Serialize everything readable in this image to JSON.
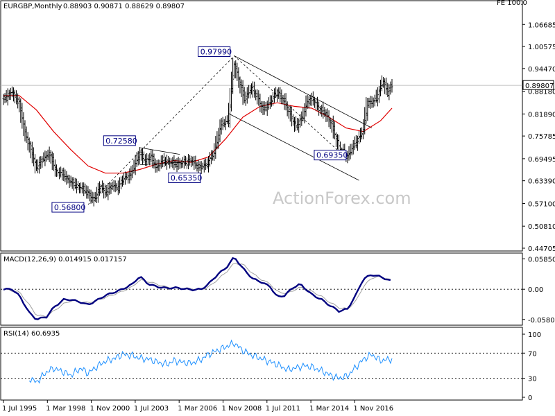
{
  "watermark": "ActionForex.com",
  "corner_label": "FE 100.0",
  "chart_data": [
    {
      "type": "ohlc",
      "symbol": "EURGBP,Monthly",
      "ohlc_readout": "0.88903 0.90871 0.88629 0.89807",
      "current_price": "0.89807",
      "ylim": [
        0.447,
        1.1
      ],
      "yticks": [
        "1.06685",
        "1.00575",
        "0.94470",
        "0.88180",
        "0.81890",
        "0.75785",
        "0.69495",
        "0.63390",
        "0.57100",
        "0.50810",
        "0.44705"
      ],
      "xticks": [
        "1 Jul 1995",
        "1 Mar 1998",
        "1 Nov 2000",
        "1 Jul 2003",
        "1 Mar 2006",
        "1 Nov 2008",
        "1 Jul 2011",
        "1 Mar 2014",
        "1 Nov 2016"
      ],
      "x_start": "1995-07",
      "x_end": "2018-02",
      "price_path": [
        [
          "1995-07",
          0.86
        ],
        [
          "1996-01",
          0.88
        ],
        [
          "1996-06",
          0.85
        ],
        [
          "1996-10",
          0.77
        ],
        [
          "1997-03",
          0.71
        ],
        [
          "1997-06",
          0.67
        ],
        [
          "1997-10",
          0.69
        ],
        [
          "1998-03",
          0.71
        ],
        [
          "1998-08",
          0.66
        ],
        [
          "1999-01",
          0.65
        ],
        [
          "1999-06",
          0.63
        ],
        [
          "1999-10",
          0.62
        ],
        [
          "2000-03",
          0.61
        ],
        [
          "2000-06",
          0.6
        ],
        [
          "2000-10",
          0.58
        ],
        [
          "2001-03",
          0.62
        ],
        [
          "2001-06",
          0.6
        ],
        [
          "2001-11",
          0.62
        ],
        [
          "2002-03",
          0.615
        ],
        [
          "2002-07",
          0.64
        ],
        [
          "2002-12",
          0.65
        ],
        [
          "2003-03",
          0.68
        ],
        [
          "2003-06",
          0.71
        ],
        [
          "2003-10",
          0.69
        ],
        [
          "2004-02",
          0.7
        ],
        [
          "2004-06",
          0.67
        ],
        [
          "2004-10",
          0.69
        ],
        [
          "2005-03",
          0.685
        ],
        [
          "2005-08",
          0.68
        ],
        [
          "2006-01",
          0.685
        ],
        [
          "2006-06",
          0.69
        ],
        [
          "2006-12",
          0.67
        ],
        [
          "2007-05",
          0.68
        ],
        [
          "2007-10",
          0.71
        ],
        [
          "2008-03",
          0.79
        ],
        [
          "2008-08",
          0.8
        ],
        [
          "2008-12",
          0.96
        ],
        [
          "2009-03",
          0.92
        ],
        [
          "2009-07",
          0.86
        ],
        [
          "2009-12",
          0.89
        ],
        [
          "2010-04",
          0.87
        ],
        [
          "2010-08",
          0.83
        ],
        [
          "2011-01",
          0.85
        ],
        [
          "2011-06",
          0.88
        ],
        [
          "2011-11",
          0.855
        ],
        [
          "2012-05",
          0.8
        ],
        [
          "2012-07",
          0.785
        ],
        [
          "2012-12",
          0.81
        ],
        [
          "2013-03",
          0.855
        ],
        [
          "2013-07",
          0.86
        ],
        [
          "2013-12",
          0.83
        ],
        [
          "2014-04",
          0.82
        ],
        [
          "2014-08",
          0.79
        ],
        [
          "2015-02",
          0.72
        ],
        [
          "2015-07",
          0.7
        ],
        [
          "2015-12",
          0.735
        ],
        [
          "2016-06",
          0.77
        ],
        [
          "2016-09",
          0.85
        ],
        [
          "2016-12",
          0.85
        ],
        [
          "2017-03",
          0.86
        ],
        [
          "2017-08",
          0.91
        ],
        [
          "2017-11",
          0.88
        ],
        [
          "2018-02",
          0.898
        ]
      ],
      "price_ma_path": [
        [
          "1995-07",
          0.87
        ],
        [
          "1996-06",
          0.87
        ],
        [
          "1997-06",
          0.83
        ],
        [
          "1998-06",
          0.77
        ],
        [
          "1999-06",
          0.72
        ],
        [
          "2000-06",
          0.675
        ],
        [
          "2001-06",
          0.655
        ],
        [
          "2002-06",
          0.655
        ],
        [
          "2003-06",
          0.665
        ],
        [
          "2004-06",
          0.68
        ],
        [
          "2005-06",
          0.69
        ],
        [
          "2006-06",
          0.685
        ],
        [
          "2007-06",
          0.7
        ],
        [
          "2008-06",
          0.75
        ],
        [
          "2009-06",
          0.81
        ],
        [
          "2010-06",
          0.84
        ],
        [
          "2011-06",
          0.85
        ],
        [
          "2012-06",
          0.84
        ],
        [
          "2013-06",
          0.835
        ],
        [
          "2014-06",
          0.81
        ],
        [
          "2015-06",
          0.78
        ],
        [
          "2016-06",
          0.77
        ],
        [
          "2017-06",
          0.8
        ],
        [
          "2018-02",
          0.835
        ]
      ],
      "annotations": [
        {
          "text": "0.97990",
          "date": "2008-12",
          "value": 0.9799
        },
        {
          "text": "0.72580",
          "date": "2003-06",
          "value": 0.7258
        },
        {
          "text": "0.65350",
          "date": "2005-06",
          "value": 0.6535
        },
        {
          "text": "0.56800",
          "date": "2000-06",
          "value": 0.568
        },
        {
          "text": "0.69350",
          "date": "2015-07",
          "value": 0.6935
        }
      ],
      "trendlines": [
        {
          "style": "dashed",
          "from": [
            "2000-06",
            0.568
          ],
          "to": [
            "2008-12",
            0.9799
          ]
        },
        {
          "style": "dashed",
          "from": [
            "2008-12",
            0.9799
          ],
          "to": [
            "2015-07",
            0.6935
          ]
        },
        {
          "style": "solid",
          "from": [
            "2008-12",
            0.9799
          ],
          "to": [
            "2016-12",
            0.78
          ]
        },
        {
          "style": "solid",
          "from": [
            "2008-08",
            0.82
          ],
          "to": [
            "2016-03",
            0.635
          ]
        },
        {
          "style": "solid",
          "from": [
            "2003-06",
            0.7258
          ],
          "to": [
            "2005-10",
            0.707
          ]
        },
        {
          "style": "solid",
          "from": [
            "2003-06",
            0.678
          ],
          "to": [
            "2005-10",
            0.685
          ]
        }
      ]
    },
    {
      "type": "line",
      "title": "MACD(12,26,9) 0.014915 0.017157",
      "ylim": [
        -0.065,
        0.0655
      ],
      "yticks": [
        "0.058502",
        "0.00",
        "-0.058054"
      ],
      "series": [
        {
          "values": [
            [
              "1995-07",
              0.0
            ],
            [
              "1996-01",
              0.0
            ],
            [
              "1996-06",
              -0.012
            ],
            [
              "1997-01",
              -0.045
            ],
            [
              "1997-06",
              -0.058
            ],
            [
              "1998-01",
              -0.053
            ],
            [
              "1998-06",
              -0.035
            ],
            [
              "1999-01",
              -0.02
            ],
            [
              "1999-06",
              -0.02
            ],
            [
              "2000-01",
              -0.025
            ],
            [
              "2000-06",
              -0.03
            ],
            [
              "2001-01",
              -0.02
            ],
            [
              "2001-06",
              -0.012
            ],
            [
              "2002-01",
              -0.005
            ],
            [
              "2002-06",
              0.0
            ],
            [
              "2003-01",
              0.01
            ],
            [
              "2003-06",
              0.025
            ],
            [
              "2003-12",
              0.01
            ],
            [
              "2004-06",
              0.005
            ],
            [
              "2005-01",
              0.002
            ],
            [
              "2005-06",
              0.003
            ],
            [
              "2006-01",
              0.001
            ],
            [
              "2006-06",
              -0.001
            ],
            [
              "2007-01",
              0.0
            ],
            [
              "2007-06",
              0.01
            ],
            [
              "2008-01",
              0.03
            ],
            [
              "2008-06",
              0.04
            ],
            [
              "2008-12",
              0.062
            ],
            [
              "2009-06",
              0.04
            ],
            [
              "2010-01",
              0.02
            ],
            [
              "2010-06",
              0.015
            ],
            [
              "2011-01",
              0.005
            ],
            [
              "2011-06",
              -0.015
            ],
            [
              "2011-11",
              -0.012
            ],
            [
              "2012-05",
              0.003
            ],
            [
              "2012-10",
              0.01
            ],
            [
              "2013-06",
              -0.01
            ],
            [
              "2014-01",
              -0.02
            ],
            [
              "2014-06",
              -0.03
            ],
            [
              "2015-01",
              -0.042
            ],
            [
              "2015-07",
              -0.038
            ],
            [
              "2016-01",
              -0.01
            ],
            [
              "2016-06",
              0.02
            ],
            [
              "2016-12",
              0.028
            ],
            [
              "2017-06",
              0.024
            ],
            [
              "2018-02",
              0.015
            ]
          ]
        },
        {
          "values": [
            [
              "1995-07",
              0.0
            ],
            [
              "1996-06",
              -0.005
            ],
            [
              "1997-01",
              -0.03
            ],
            [
              "1997-06",
              -0.05
            ],
            [
              "1998-01",
              -0.052
            ],
            [
              "1998-06",
              -0.042
            ],
            [
              "1999-01",
              -0.028
            ],
            [
              "1999-06",
              -0.022
            ],
            [
              "2000-06",
              -0.026
            ],
            [
              "2001-06",
              -0.016
            ],
            [
              "2002-06",
              -0.004
            ],
            [
              "2003-01",
              0.005
            ],
            [
              "2003-06",
              0.018
            ],
            [
              "2004-01",
              0.014
            ],
            [
              "2005-01",
              0.004
            ],
            [
              "2006-01",
              0.002
            ],
            [
              "2007-01",
              0.0
            ],
            [
              "2007-06",
              0.004
            ],
            [
              "2008-01",
              0.02
            ],
            [
              "2008-06",
              0.032
            ],
            [
              "2008-12",
              0.05
            ],
            [
              "2009-06",
              0.048
            ],
            [
              "2010-01",
              0.03
            ],
            [
              "2010-06",
              0.02
            ],
            [
              "2011-01",
              0.01
            ],
            [
              "2011-06",
              -0.005
            ],
            [
              "2012-01",
              -0.008
            ],
            [
              "2012-10",
              0.004
            ],
            [
              "2013-06",
              -0.004
            ],
            [
              "2014-01",
              -0.014
            ],
            [
              "2014-06",
              -0.024
            ],
            [
              "2015-01",
              -0.035
            ],
            [
              "2015-07",
              -0.038
            ],
            [
              "2016-01",
              -0.022
            ],
            [
              "2016-06",
              0.005
            ],
            [
              "2016-12",
              0.022
            ],
            [
              "2017-06",
              0.025
            ],
            [
              "2018-02",
              0.017
            ]
          ]
        }
      ]
    },
    {
      "type": "line",
      "title": "RSI(14) 60.6935",
      "ylim": [
        0,
        100
      ],
      "yticks": [
        "100",
        "70",
        "30",
        "0"
      ],
      "levels": [
        70,
        30
      ],
      "values": [
        [
          "1997-01",
          30
        ],
        [
          "1997-06",
          24
        ],
        [
          "1998-01",
          40
        ],
        [
          "1998-06",
          46
        ],
        [
          "1999-01",
          40
        ],
        [
          "1999-06",
          35
        ],
        [
          "2000-01",
          46
        ],
        [
          "2000-06",
          38
        ],
        [
          "2001-01",
          50
        ],
        [
          "2001-06",
          57
        ],
        [
          "2002-01",
          62
        ],
        [
          "2002-06",
          68
        ],
        [
          "2003-01",
          66
        ],
        [
          "2003-06",
          62
        ],
        [
          "2004-01",
          60
        ],
        [
          "2004-06",
          56
        ],
        [
          "2005-01",
          52
        ],
        [
          "2005-06",
          58
        ],
        [
          "2006-01",
          55
        ],
        [
          "2006-06",
          54
        ],
        [
          "2007-01",
          60
        ],
        [
          "2007-06",
          68
        ],
        [
          "2008-01",
          75
        ],
        [
          "2008-06",
          80
        ],
        [
          "2008-12",
          86
        ],
        [
          "2009-06",
          74
        ],
        [
          "2010-01",
          66
        ],
        [
          "2010-06",
          62
        ],
        [
          "2011-01",
          56
        ],
        [
          "2011-06",
          52
        ],
        [
          "2012-01",
          44
        ],
        [
          "2012-06",
          46
        ],
        [
          "2013-01",
          50
        ],
        [
          "2013-06",
          48
        ],
        [
          "2014-01",
          42
        ],
        [
          "2014-06",
          36
        ],
        [
          "2015-01",
          30
        ],
        [
          "2015-07",
          34
        ],
        [
          "2016-01",
          48
        ],
        [
          "2016-06",
          60
        ],
        [
          "2016-12",
          68
        ],
        [
          "2017-06",
          58
        ],
        [
          "2018-02",
          60.69
        ]
      ]
    }
  ]
}
